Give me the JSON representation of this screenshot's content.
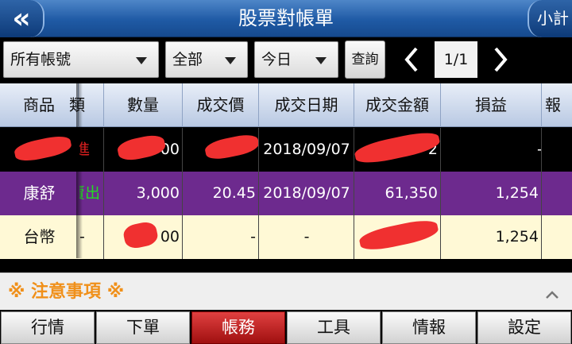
{
  "header": {
    "back_label": "«",
    "title": "股票對帳單",
    "subtotal_label": "小計"
  },
  "filters": {
    "account": "所有帳號",
    "category": "全部",
    "period": "今日",
    "query_label": "查詢",
    "page_indicator": "1/1",
    "prev_icon": "chevron-left-icon",
    "next_icon": "chevron-right-icon"
  },
  "table": {
    "headers": [
      "商品",
      "類",
      "數量",
      "成交價",
      "成交日期",
      "成交金額",
      "損益",
      "報酬"
    ],
    "rows": [
      {
        "product": "",
        "type": "進",
        "qty": "00",
        "price": "",
        "date": "2018/09/07",
        "amount": "2",
        "pnl": "",
        "ret": "-"
      },
      {
        "product": "康舒",
        "type": "賣出",
        "qty": "3,000",
        "price": "20.45",
        "date": "2018/09/07",
        "amount": "61,350",
        "pnl": "1,254",
        "ret": ""
      },
      {
        "product": "台幣",
        "type": "-",
        "qty": "00",
        "price": "-",
        "date": "-",
        "amount": "",
        "pnl": "1,254",
        "ret": ""
      }
    ]
  },
  "notice": {
    "label": "※ 注意事項 ※",
    "toggle_icon": "chevron-up-icon"
  },
  "tabs": [
    {
      "label": "行情"
    },
    {
      "label": "下單"
    },
    {
      "label": "帳務",
      "active": true
    },
    {
      "label": "工具"
    },
    {
      "label": "情報"
    },
    {
      "label": "設定"
    }
  ],
  "colors": {
    "header_blue": "#1f5aa5",
    "buy_text": "#e02020",
    "sell_text": "#22dd22",
    "row_highlight": "#6d2a8e",
    "row_total": "#fff9d6",
    "active_tab": "#c02020",
    "notice_text": "#f0901a"
  }
}
